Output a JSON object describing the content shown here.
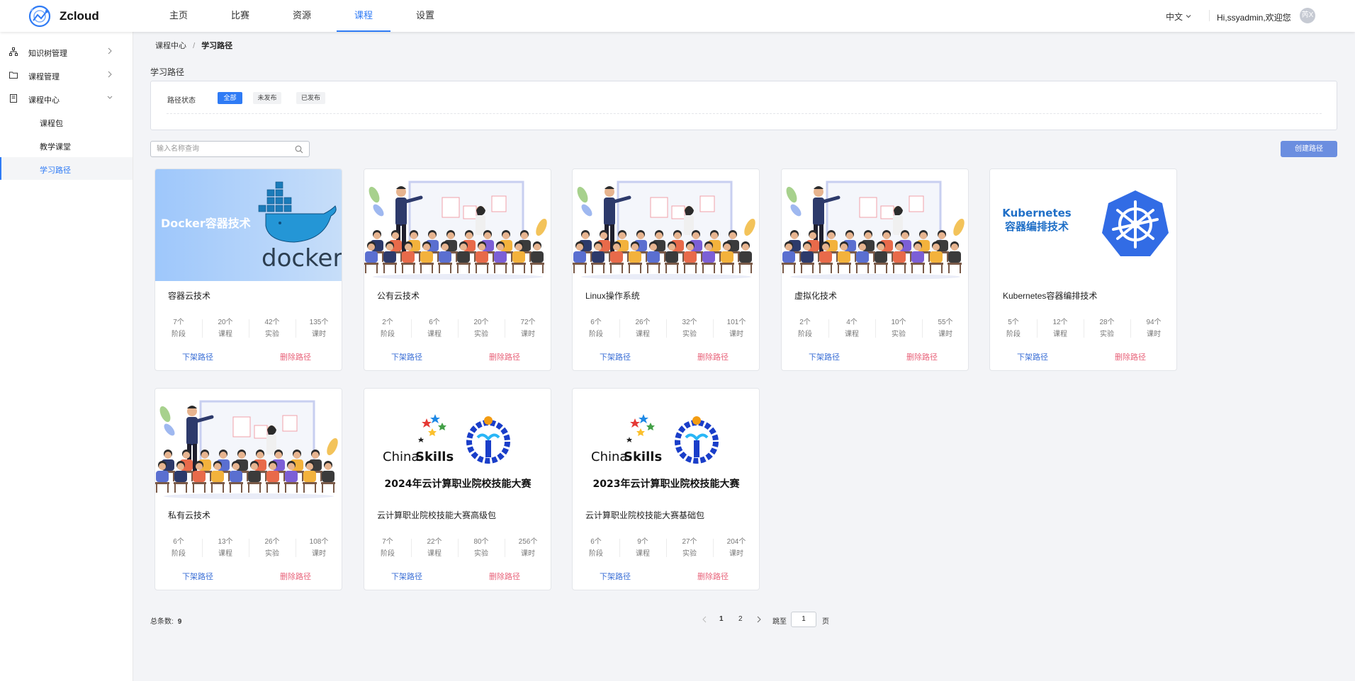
{
  "app": {
    "name": "Zcloud"
  },
  "nav": [
    {
      "label": "主页",
      "active": false
    },
    {
      "label": "比赛",
      "active": false
    },
    {
      "label": "资源",
      "active": false
    },
    {
      "label": "课程",
      "active": true
    },
    {
      "label": "设置",
      "active": false
    }
  ],
  "header": {
    "language": "中文",
    "greeting": "Hi,ssyadmin,欢迎您",
    "avatar_text": "芮X"
  },
  "sidebar": {
    "items": [
      {
        "label": "知识树管理",
        "icon": "tree-icon"
      },
      {
        "label": "课程管理",
        "icon": "folder-icon"
      },
      {
        "label": "课程中心",
        "icon": "book-icon"
      }
    ],
    "subitems": [
      {
        "label": "课程包",
        "active": false
      },
      {
        "label": "教学课堂",
        "active": false
      },
      {
        "label": "学习路径",
        "active": true
      }
    ]
  },
  "breadcrumb": {
    "parent": "课程中心",
    "separator": "/",
    "current": "学习路径"
  },
  "page_title": "学习路径",
  "filter": {
    "label": "路径状态",
    "chips": [
      "全部",
      "未发布",
      "已发布"
    ],
    "active_chip": "全部"
  },
  "search": {
    "placeholder": "输入名称查询",
    "value": ""
  },
  "create_button": "创建路径",
  "stat_units": [
    "阶段",
    "课程",
    "实验",
    "课时"
  ],
  "actions": {
    "offline": "下架路径",
    "delete": "删除路径"
  },
  "cards": [
    {
      "title": "容器云技术",
      "thumb": "docker",
      "thumb_text": "Docker容器技术",
      "thumb_logo": "docker",
      "stats": [
        "7个",
        "20个",
        "42个",
        "135个"
      ]
    },
    {
      "title": "公有云技术",
      "thumb": "classroom",
      "stats": [
        "2个",
        "6个",
        "20个",
        "72个"
      ]
    },
    {
      "title": "Linux操作系统",
      "thumb": "classroom",
      "stats": [
        "6个",
        "26个",
        "32个",
        "101个"
      ]
    },
    {
      "title": "虚拟化技术",
      "thumb": "classroom",
      "stats": [
        "2个",
        "4个",
        "10个",
        "55个"
      ]
    },
    {
      "title": "Kubernetes容器编排技术",
      "thumb": "kubernetes",
      "thumb_text1": "Kubernetes",
      "thumb_text2": "容器编排技术",
      "stats": [
        "5个",
        "12个",
        "28个",
        "94个"
      ]
    },
    {
      "title": "私有云技术",
      "thumb": "classroom",
      "stats": [
        "6个",
        "13个",
        "26个",
        "108个"
      ]
    },
    {
      "title": "云计算职业院校技能大赛高级包",
      "thumb": "chinaskills",
      "thumb_brand_a": "China",
      "thumb_brand_b": "Skills",
      "thumb_caption": "2024年云计算职业院校技能大赛",
      "stats": [
        "7个",
        "22个",
        "80个",
        "256个"
      ]
    },
    {
      "title": "云计算职业院校技能大赛基础包",
      "thumb": "chinaskills",
      "thumb_brand_a": "China",
      "thumb_brand_b": "Skills",
      "thumb_caption": "2023年云计算职业院校技能大赛",
      "stats": [
        "6个",
        "9个",
        "27个",
        "204个"
      ]
    }
  ],
  "pagination": {
    "total_label": "总条数:",
    "total": "9",
    "pages": [
      "1",
      "2"
    ],
    "current": "1",
    "jump_label": "跳至",
    "jump_value": "1",
    "page_suffix": "页"
  },
  "colors": {
    "primary": "#2f7bf5",
    "create_button": "#6b8ee0",
    "delete": "#e8637a",
    "docker_bg": "#a9cdfb",
    "k8s": "#326ce5"
  }
}
